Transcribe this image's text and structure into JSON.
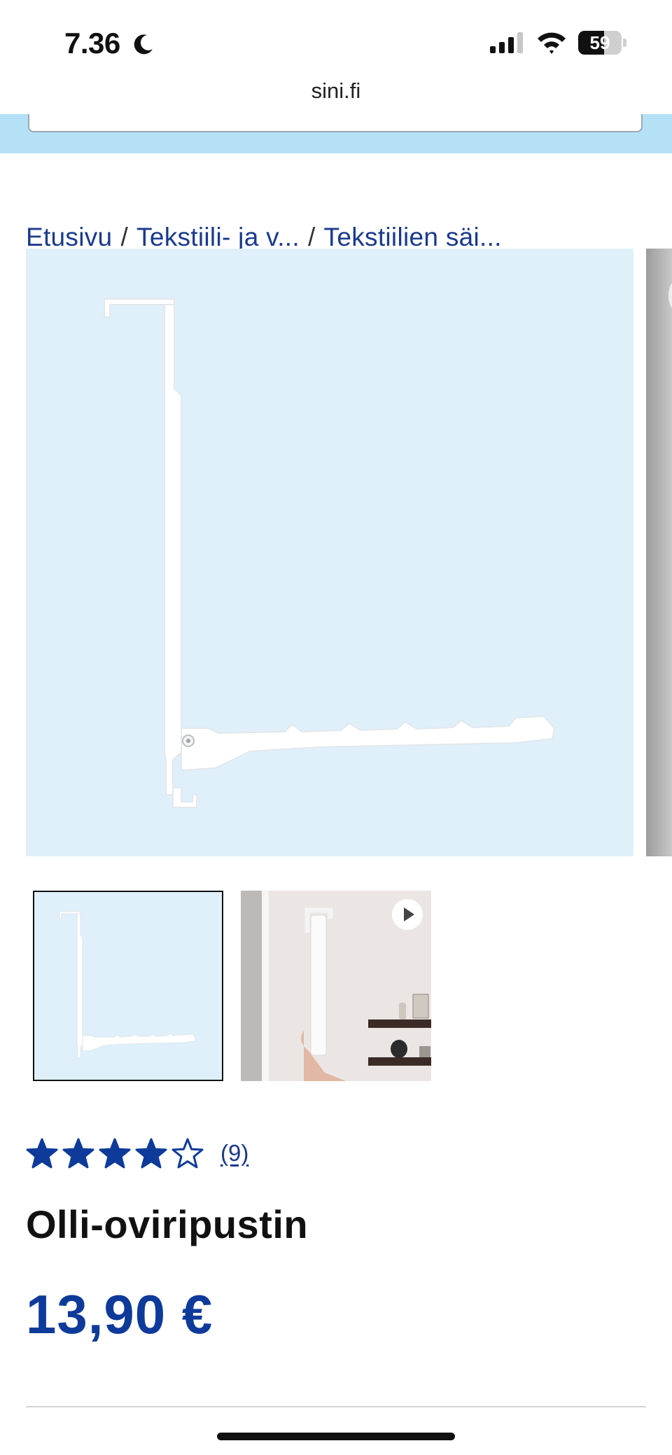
{
  "status_bar": {
    "time": "7.36",
    "battery_level": "59",
    "battery_fraction": 0.59,
    "icons": [
      "moon-icon",
      "cellular-signal-icon",
      "wifi-icon",
      "battery-icon"
    ]
  },
  "browser": {
    "url": "sini.fi"
  },
  "breadcrumb": {
    "items": [
      "Etusivu",
      "Tekstiili- ja v...",
      "Tekstiilien säi..."
    ],
    "separator": "/"
  },
  "gallery": {
    "thumbnails": [
      {
        "kind": "image",
        "selected": true
      },
      {
        "kind": "video",
        "selected": false,
        "icon": "play-icon"
      }
    ]
  },
  "product": {
    "rating": 4,
    "rating_max": 5,
    "review_count": "(9)",
    "title": "Olli-oviripustin",
    "price": "13,90 €"
  },
  "colors": {
    "brand_blue": "#0e3a9a",
    "link_blue": "#1a3a8c",
    "header_light_blue": "#b4e1f6",
    "image_background": "#dff0fb"
  }
}
